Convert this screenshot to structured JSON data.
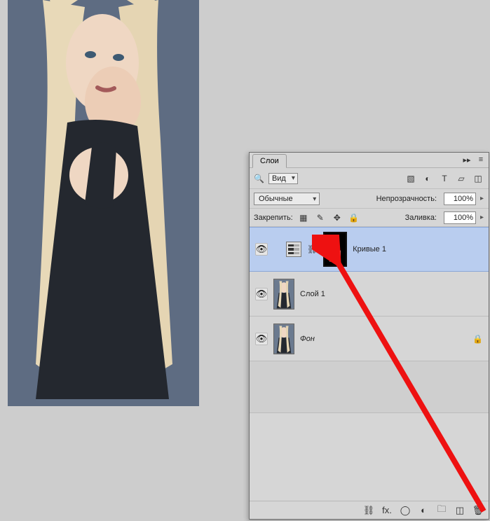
{
  "panel": {
    "tab_label": "Слои",
    "filter_kind_label": "Вид",
    "blend_mode": "Обычные",
    "opacity_label": "Непрозрачность:",
    "opacity_value": "100%",
    "lock_label": "Закрепить:",
    "fill_label": "Заливка:",
    "fill_value": "100%"
  },
  "layers": [
    {
      "name": "Кривые 1",
      "type": "adjustment",
      "selected": true,
      "visible": true,
      "locked": false
    },
    {
      "name": "Слой 1",
      "type": "raster",
      "selected": false,
      "visible": true,
      "locked": false
    },
    {
      "name": "Фон",
      "type": "raster",
      "selected": false,
      "visible": true,
      "locked": true
    }
  ],
  "icons": {
    "collapse": "▸▸",
    "menu": "≡",
    "search": "🔍",
    "filter_image": "▧",
    "filter_adjust": "◐",
    "filter_text": "T",
    "filter_shape": "▱",
    "filter_smart": "◫",
    "lock_pixels": "▦",
    "lock_brush": "✎",
    "lock_move": "✥",
    "lock_all": "🔒",
    "eye": "👁",
    "link": "⛓",
    "fx": "fx.",
    "mask_btn": "◯",
    "adjust_btn": "◐",
    "folder": "🗀",
    "new": "◫",
    "trash": "🗑"
  }
}
